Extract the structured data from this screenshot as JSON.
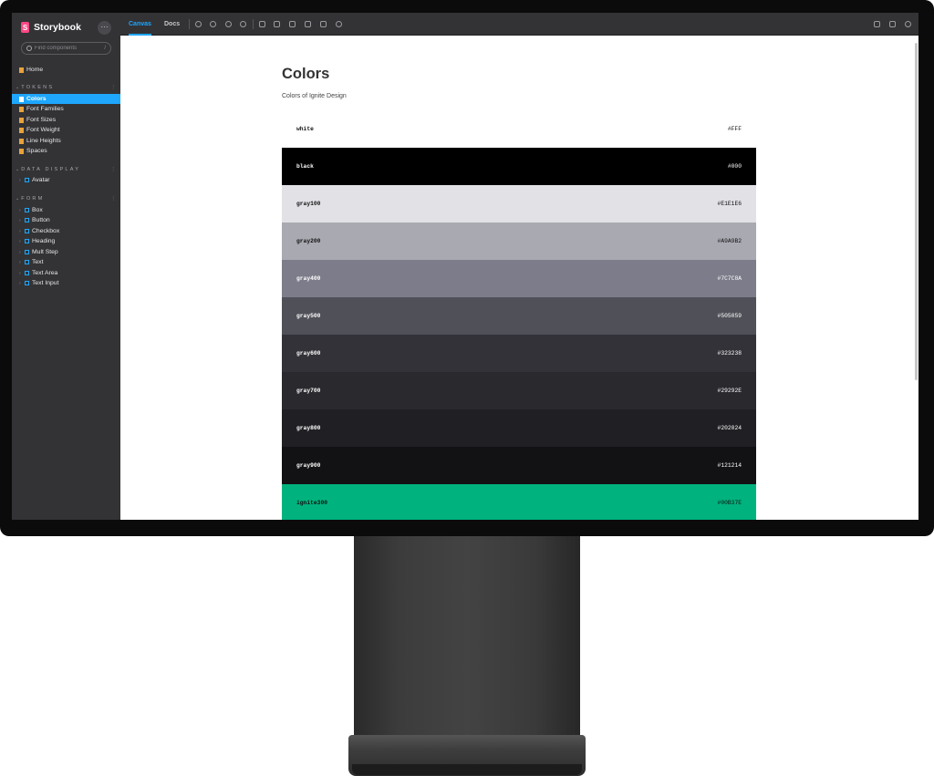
{
  "sidebar": {
    "brand": "Storybook",
    "more_glyph": "···",
    "search_placeholder": "Find components",
    "search_shortcut": "/",
    "home_label": "Home",
    "groups": [
      {
        "label": "TOKENS",
        "items": [
          "Colors",
          "Font Families",
          "Font Sizes",
          "Font Weight",
          "Line Heights",
          "Spaces"
        ]
      },
      {
        "label": "DATA DISPLAY",
        "items": [
          "Avatar"
        ]
      },
      {
        "label": "FORM",
        "items": [
          "Box",
          "Button",
          "Checkbox",
          "Heading",
          "Mult Step",
          "Text",
          "Text Area",
          "Text Input"
        ]
      }
    ],
    "active_item": "Colors"
  },
  "toolbar": {
    "tabs": [
      "Canvas",
      "Docs"
    ],
    "active_tab": "Canvas",
    "tool_icons": [
      "refresh-icon",
      "zoom-in-icon",
      "zoom-out-icon",
      "zoom-reset-icon",
      "background-icon",
      "grid-icon",
      "measure-icon",
      "outline-icon",
      "viewport-icon",
      "accessibility-icon"
    ],
    "right_icons": [
      "fullscreen-icon",
      "open-new-tab-icon",
      "copy-link-icon"
    ]
  },
  "doc": {
    "title": "Colors",
    "subtitle": "Colors of Ignite Design"
  },
  "colors": [
    {
      "name": "white",
      "hex": "#FFF",
      "bg": "#FFFFFF",
      "fg": "#111111"
    },
    {
      "name": "black",
      "hex": "#000",
      "bg": "#000000",
      "fg": "#FFFFFF"
    },
    {
      "name": "gray100",
      "hex": "#E1E1E6",
      "bg": "#E1E1E6",
      "fg": "#111111"
    },
    {
      "name": "gray200",
      "hex": "#A9A9B2",
      "bg": "#A9A9B2",
      "fg": "#111111"
    },
    {
      "name": "gray400",
      "hex": "#7C7C8A",
      "bg": "#7C7C8A",
      "fg": "#FFFFFF"
    },
    {
      "name": "gray500",
      "hex": "#505059",
      "bg": "#505059",
      "fg": "#FFFFFF"
    },
    {
      "name": "gray600",
      "hex": "#323238",
      "bg": "#323238",
      "fg": "#FFFFFF"
    },
    {
      "name": "gray700",
      "hex": "#29292E",
      "bg": "#29292E",
      "fg": "#FFFFFF"
    },
    {
      "name": "gray800",
      "hex": "#202024",
      "bg": "#202024",
      "fg": "#FFFFFF"
    },
    {
      "name": "gray900",
      "hex": "#121214",
      "bg": "#121214",
      "fg": "#FFFFFF"
    },
    {
      "name": "ignite300",
      "hex": "#00B37E",
      "bg": "#00B37E",
      "fg": "#111111"
    }
  ],
  "theme": {
    "accent": "#1ea7fd",
    "brand": "#ff4785"
  }
}
